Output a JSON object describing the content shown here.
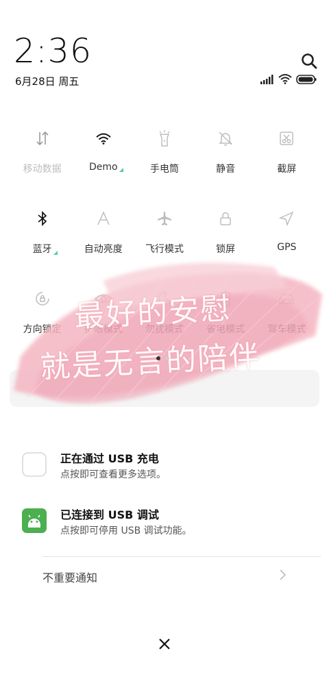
{
  "header": {
    "time": "2:36",
    "date": "6月28日 周五"
  },
  "quick_settings": {
    "tiles": [
      {
        "label": "移动数据",
        "icon": "mobile-data-icon",
        "state": "off"
      },
      {
        "label": "Demo",
        "icon": "wifi-icon",
        "state": "on"
      },
      {
        "label": "手电筒",
        "icon": "flashlight-icon",
        "state": "off"
      },
      {
        "label": "静音",
        "icon": "mute-bell-icon",
        "state": "off"
      },
      {
        "label": "截屏",
        "icon": "screenshot-icon",
        "state": "off"
      },
      {
        "label": "蓝牙",
        "icon": "bluetooth-icon",
        "state": "on"
      },
      {
        "label": "自动亮度",
        "icon": "auto-brightness-icon",
        "state": "off"
      },
      {
        "label": "飞行模式",
        "icon": "airplane-icon",
        "state": "off"
      },
      {
        "label": "锁屏",
        "icon": "lock-icon",
        "state": "off"
      },
      {
        "label": "GPS",
        "icon": "gps-icon",
        "state": "off"
      },
      {
        "label": "方向锁定",
        "icon": "rotation-lock-icon",
        "state": "off"
      },
      {
        "label": "护眼模式",
        "icon": "eye-icon",
        "state": "off"
      },
      {
        "label": "勿扰模式",
        "icon": "moon-icon",
        "state": "off"
      },
      {
        "label": "省电模式",
        "icon": "battery-saver-icon",
        "state": "off"
      },
      {
        "label": "驾车模式",
        "icon": "car-icon",
        "state": "off"
      }
    ],
    "page_count": 2,
    "active_page": 1
  },
  "watermark": {
    "line1": "最好的安慰",
    "line2": "就是无言的陪伴"
  },
  "notifications": [
    {
      "title": "正在通过 USB 充电",
      "body": "点按即可查看更多选项。",
      "icon": "usb-charging-icon"
    },
    {
      "title": "已连接到 USB 调试",
      "body": "点按即可停用 USB 调试功能。",
      "icon": "android-debug-icon"
    }
  ],
  "unimportant_label": "不重要通知",
  "colors": {
    "accent_corner": "#4ecdb0",
    "debug_icon_bg": "#4caf50",
    "watermark_pink": "#f2a7b4"
  }
}
